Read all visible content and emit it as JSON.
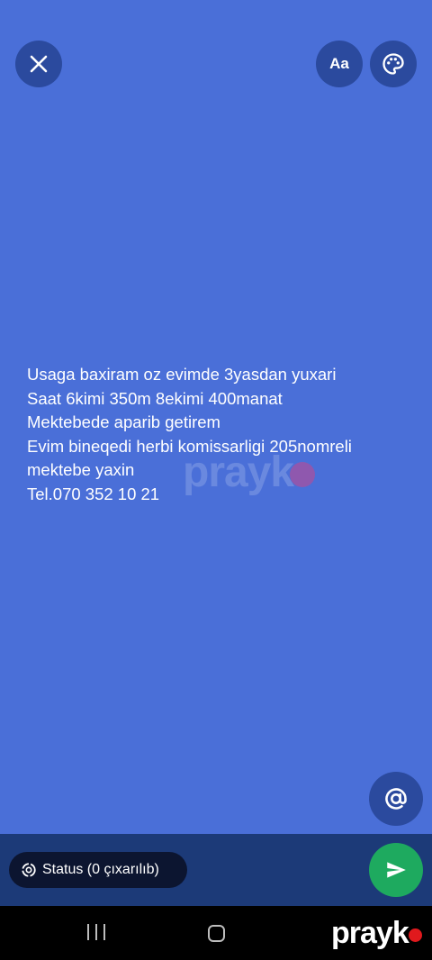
{
  "toolbar": {
    "close_icon": "close-icon",
    "font_label": "Aa",
    "palette_icon": "palette-icon"
  },
  "status": {
    "lines": [
      "Usaga baxiram oz evimde 3yasdan yuxari",
      "Saat 6kimi 350m 8ekimi 400manat",
      "Mektebede aparib getirem",
      "Evim bineqedi herbi komissarligi 205nomreli",
      "mektebe yaxin",
      "Tel.070 352 10 21"
    ],
    "background_color": "#4a6fd8"
  },
  "watermark": {
    "text": "prayk"
  },
  "mention": {
    "icon": "at-sign-icon"
  },
  "bottom": {
    "chip_label": "Status (0 çıxarılıb)",
    "send_icon": "send-icon",
    "send_color": "#1eaa5f"
  },
  "navbar": {
    "recents_icon": "recents-icon",
    "home_icon": "home-icon",
    "brand": "prayk"
  }
}
